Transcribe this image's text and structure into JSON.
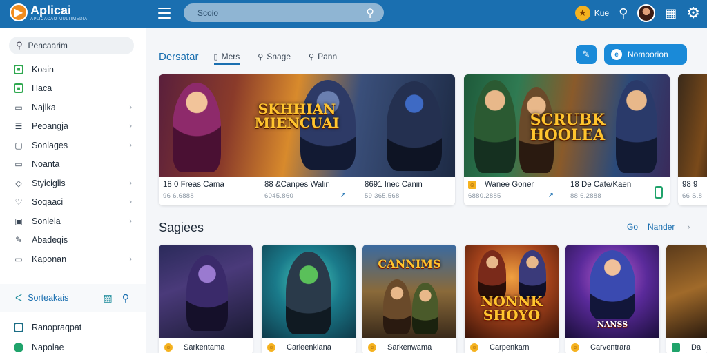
{
  "app": {
    "title": "Aplicai",
    "subtitle": "APLICACAO MULTIMEDIA"
  },
  "header": {
    "search_placeholder": "Scoio",
    "user_label": "Kue",
    "icons": [
      "menu-icon",
      "search-icon",
      "gift-icon",
      "search-icon",
      "avatar",
      "bookmark-icon",
      "gear-icon"
    ]
  },
  "sidebar": {
    "search_label": "Pencaarim",
    "items": [
      {
        "label": "Koain",
        "icon": "green-square-icon",
        "chevron": false
      },
      {
        "label": "Haca",
        "icon": "green-square-icon",
        "chevron": false
      },
      {
        "label": "Najlka",
        "icon": "bookmark-icon",
        "chevron": true
      },
      {
        "label": "Peoangja",
        "icon": "list-icon",
        "chevron": true
      },
      {
        "label": "Sonlages",
        "icon": "card-icon",
        "chevron": true
      },
      {
        "label": "Noanta",
        "icon": "box-icon",
        "chevron": false
      },
      {
        "label": "Styiciglis",
        "icon": "shield-icon",
        "chevron": true
      },
      {
        "label": "Soqaaci",
        "icon": "heart-icon",
        "chevron": true
      },
      {
        "label": "Sonlela",
        "icon": "lock-icon",
        "chevron": true
      },
      {
        "label": "Abadeqis",
        "icon": "pen-icon",
        "chevron": false
      },
      {
        "label": "Kaponan",
        "icon": "box-icon",
        "chevron": true
      }
    ],
    "section": {
      "label": "Sorteakais"
    },
    "bottom_items": [
      {
        "label": "Ranopraqpat"
      },
      {
        "label": "Napolae"
      }
    ]
  },
  "main": {
    "tabs": [
      {
        "label": "Dersatar",
        "icon": ""
      },
      {
        "label": "Mers",
        "icon": "book-icon"
      },
      {
        "label": "Snage",
        "icon": "search-icon"
      },
      {
        "label": "Pann",
        "icon": "search-icon"
      }
    ],
    "primary_button": "Nomoorion",
    "featured": [
      {
        "title_art": "SKHHIAN MIENCUAI",
        "name": "18 0 Freas Cama",
        "meta": "96 6.6888",
        "action": ""
      },
      {
        "title_art": "",
        "name": "88 &Canpes Walin",
        "meta": "6045.860",
        "action": "↗"
      },
      {
        "title_art": "",
        "name": "8691 Inec Canin",
        "meta": "59 365.568",
        "action": ""
      },
      {
        "title_art": "SCRUBK HOOLEA",
        "name": "Wanee Goner",
        "meta": "6880.2885",
        "action": "↗"
      },
      {
        "title_art": "",
        "name": "18 De Cate/Kaen",
        "meta": "88 6.2888",
        "action": ""
      },
      {
        "title_art": "",
        "name": "98 9",
        "meta": "66 S.8",
        "action": ""
      }
    ],
    "section_title": "Sagiees",
    "section_link": "Nander",
    "games": [
      {
        "title_art": "",
        "name": "Sarkentama"
      },
      {
        "title_art": "",
        "name": "Carleenkiana"
      },
      {
        "title_art": "CANNIMS",
        "name": "Sarkenwama"
      },
      {
        "title_art": "NONNK SHOYO",
        "name": "Carpenkarn"
      },
      {
        "title_art": "NANSS",
        "name": "Carventrara"
      },
      {
        "title_art": "",
        "name": "Da"
      }
    ]
  },
  "colors": {
    "brand": "#1a6fb0",
    "accent": "#1a8ad8",
    "green": "#2fa84f",
    "gold": "#ffc42e"
  }
}
